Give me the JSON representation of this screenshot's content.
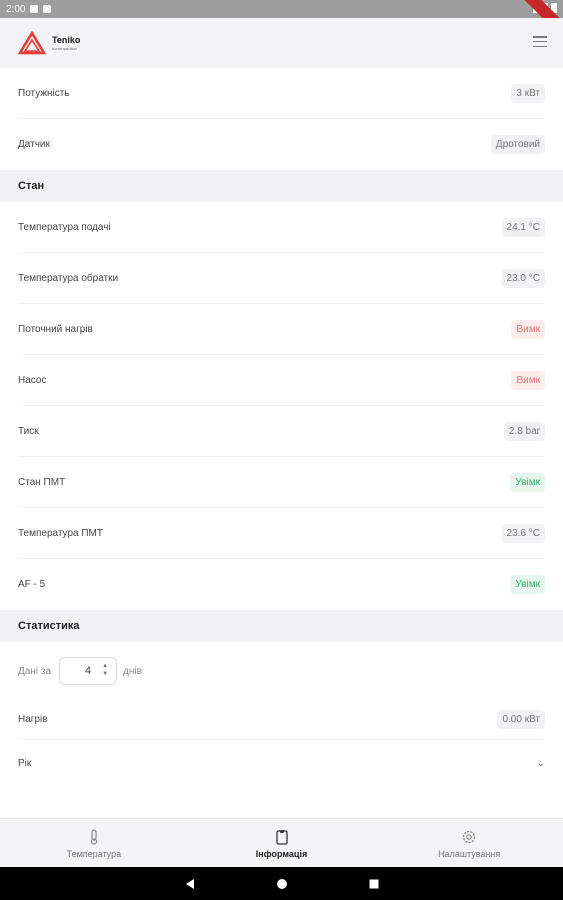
{
  "status_bar": {
    "time": "2:00"
  },
  "app": {
    "brand_name": "Teniko",
    "brand_sub": "home solution",
    "menu_icon": "hamburger-icon",
    "accent_color": "#e53935"
  },
  "top_rows": [
    {
      "label": "Потужність",
      "value": "3 кВт",
      "state": "neutral"
    },
    {
      "label": "Датчик",
      "value": "Дротовий",
      "state": "neutral"
    }
  ],
  "state_section": {
    "title": "Стан",
    "rows": [
      {
        "label": "Температура подачі",
        "value": "24.1 °C",
        "state": "neutral"
      },
      {
        "label": "Температура обратки",
        "value": "23.0 °C",
        "state": "neutral"
      },
      {
        "label": "Поточний нагрів",
        "value": "Вимк",
        "state": "off"
      },
      {
        "label": "Насос",
        "value": "Вимк",
        "state": "off"
      },
      {
        "label": "Тиск",
        "value": "2.8 bar",
        "state": "neutral"
      },
      {
        "label": "Стан ПМТ",
        "value": "Увімк",
        "state": "on"
      },
      {
        "label": "Температура ПМТ",
        "value": "23.6 °C",
        "state": "neutral"
      },
      {
        "label": "AF - 5",
        "value": "Увімк",
        "state": "on"
      }
    ]
  },
  "stats_section": {
    "title": "Статистика",
    "days_prefix": "Дані за",
    "days_value": "4",
    "days_suffix": "днів",
    "heating_label": "Нагрів",
    "heating_value": "0.00 кВт",
    "year_label": "Рік"
  },
  "bottom_nav": [
    {
      "label": "Температура",
      "icon": "thermometer-icon",
      "active": false
    },
    {
      "label": "Інформація",
      "icon": "clipboard-icon",
      "active": true
    },
    {
      "label": "Налаштування",
      "icon": "gear-icon",
      "active": false
    }
  ]
}
